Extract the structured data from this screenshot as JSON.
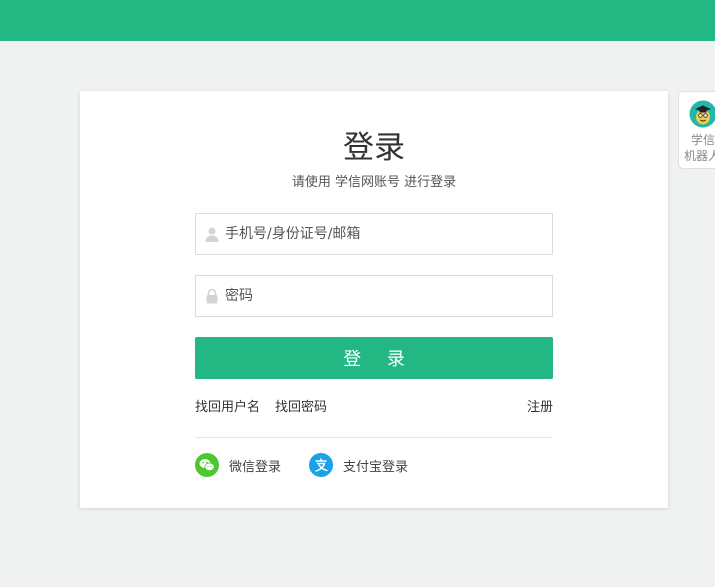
{
  "login": {
    "title": "登录",
    "subtitle": "请使用 学信网账号 进行登录",
    "username_placeholder": "手机号/身份证号/邮箱",
    "password_placeholder": "密码",
    "submit_label": "登 录",
    "recover_username": "找回用户名",
    "recover_password": "找回密码",
    "register": "注册",
    "wechat_login": "微信登录",
    "alipay_login": "支付宝登录"
  },
  "robot": {
    "line1": "学信",
    "line2": "机器人"
  },
  "colors": {
    "brand": "#22b783",
    "wechat": "#4cc72f",
    "alipay": "#1aa1e8"
  },
  "icons": [
    "user-icon",
    "lock-icon",
    "wechat-icon",
    "alipay-icon",
    "robot-avatar-icon"
  ]
}
